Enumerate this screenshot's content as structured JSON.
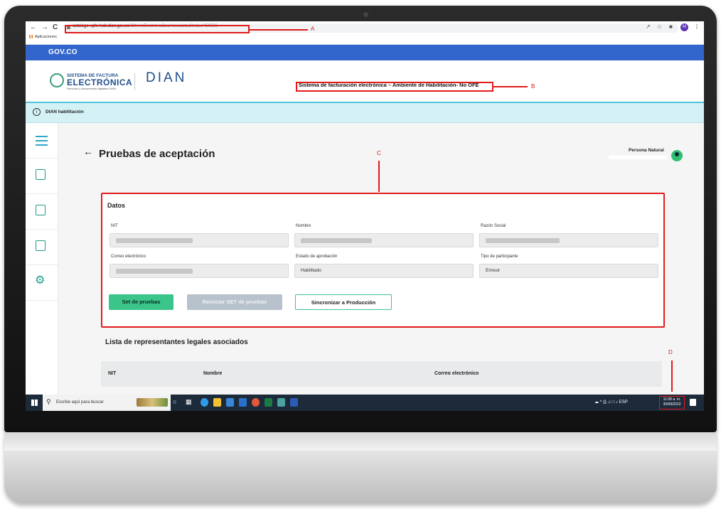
{
  "browser": {
    "url_host": "catalogo-vpfe-hab.dian.gov.co",
    "url_path": "/OthersElectronicDocAssociated/Index/450566",
    "bookmark_apps": "Aplicaciones",
    "profile_initial": "M"
  },
  "gov_bar": {
    "label": "GOV.CO"
  },
  "header": {
    "logo_line1": "SISTEMA DE FACTURA",
    "logo_line2": "ELECTRÓNICA",
    "logo_line3": "Servicios y documentos digitales DIAN",
    "dian_logo": "DIAN",
    "environment_title": "Sistema de facturación electrónica – Ambiente de Habilitación- No OFE"
  },
  "info_bar": {
    "text": "DIAN habilitación"
  },
  "page": {
    "title": "Pruebas de aceptación",
    "user_name": "Persona Natural"
  },
  "datos": {
    "title": "Datos",
    "fields": {
      "nit_label": "NIT",
      "nombre_label": "Nombre",
      "razon_label": "Razón Social",
      "correo_label": "Correo electrónico",
      "estado_label": "Estado de aprobación",
      "estado_value": "Habilitado",
      "tipo_label": "Tipo de participante",
      "tipo_value": "Emisor"
    },
    "buttons": {
      "set_pruebas": "Set de pruebas",
      "reiniciar": "Reiniciar SET de pruebas",
      "sincronizar": "Sincronizar a Producción"
    }
  },
  "representantes": {
    "title": "Lista de representantes legales asociados",
    "columns": [
      "NIT",
      "Nombre",
      "Correo electrónico"
    ]
  },
  "taskbar": {
    "search_placeholder": "Escribe aquí para buscar",
    "language": "ESP",
    "time": "11:08 a. m.",
    "date": "30/08/2022"
  },
  "annotations": {
    "a": "A",
    "b": "B",
    "c": "C",
    "d": "D"
  }
}
